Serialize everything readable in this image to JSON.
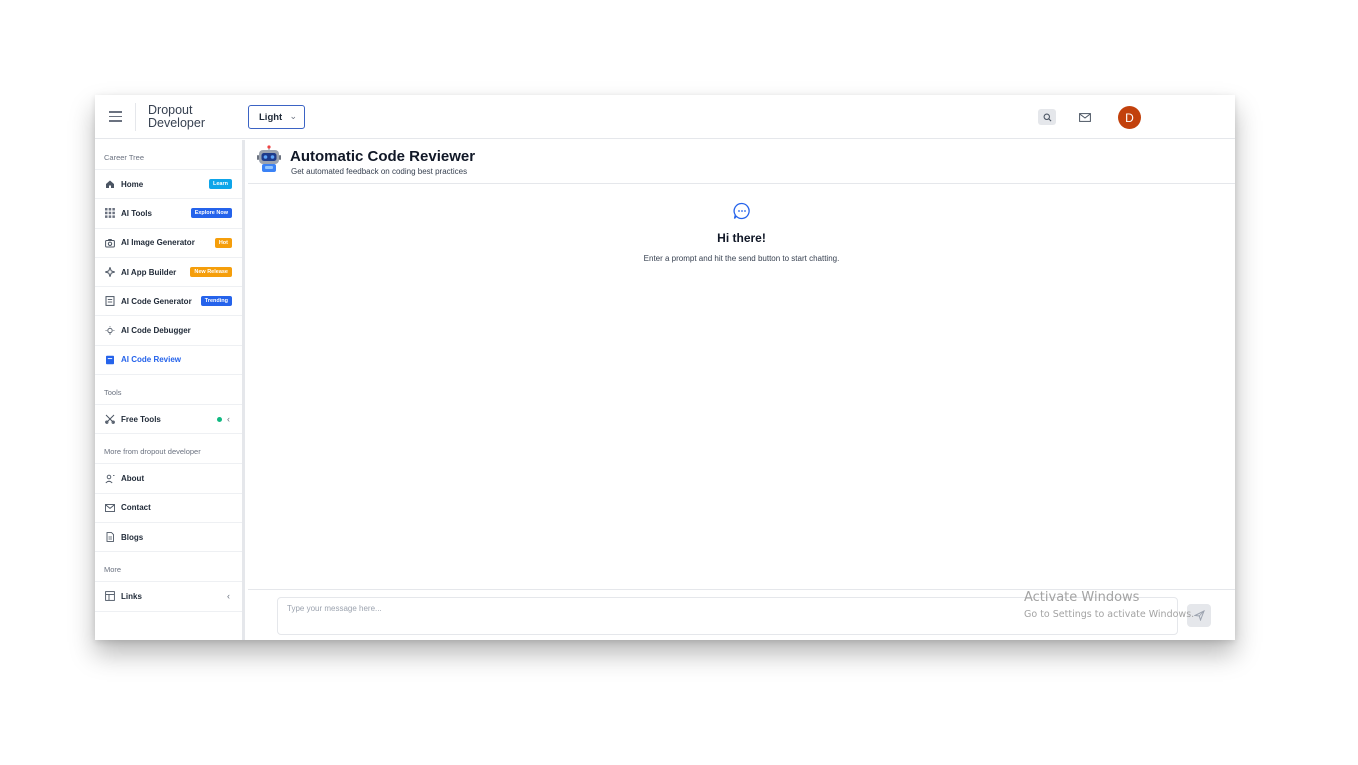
{
  "header": {
    "brand_line1": "Dropout",
    "brand_line2": "Developer",
    "theme_selected": "Light",
    "avatar_initial": "D"
  },
  "sidebar": {
    "sections": [
      {
        "label": "Career Tree"
      },
      {
        "label": "Tools"
      },
      {
        "label": "More from dropout developer"
      },
      {
        "label": "More"
      }
    ],
    "career_items": [
      {
        "label": "Home",
        "icon": "home-icon",
        "badge": "Learn"
      },
      {
        "label": "AI Tools",
        "icon": "grid-icon",
        "badge": "Explore Now"
      },
      {
        "label": "AI Image Generator",
        "icon": "camera-icon",
        "badge": "Hot"
      },
      {
        "label": "AI App Builder",
        "icon": "sparkle-icon",
        "badge": "New Release"
      },
      {
        "label": "AI Code Generator",
        "icon": "code-file-icon",
        "badge": "Trending"
      },
      {
        "label": "AI Code Debugger",
        "icon": "bulb-icon",
        "badge": ""
      },
      {
        "label": "AI Code Review",
        "icon": "review-icon",
        "badge": ""
      }
    ],
    "tools_items": [
      {
        "label": "Free Tools",
        "icon": "scissors-icon"
      }
    ],
    "more_from_items": [
      {
        "label": "About",
        "icon": "person-icon"
      },
      {
        "label": "Contact",
        "icon": "mail-icon"
      },
      {
        "label": "Blogs",
        "icon": "document-icon"
      }
    ],
    "more_items": [
      {
        "label": "Links",
        "icon": "layout-icon"
      }
    ]
  },
  "main": {
    "title": "Automatic Code Reviewer",
    "subtitle": "Get automated feedback on coding best practices",
    "welcome_title": "Hi there!",
    "welcome_text": "Enter a prompt and hit the send button to start chatting.",
    "input_placeholder": "Type your message here...",
    "input_value": ""
  },
  "watermark": {
    "title": "Activate Windows",
    "subtitle": "Go to Settings to activate Windows."
  },
  "colors": {
    "accent": "#2563eb",
    "avatar": "#c2410c",
    "badge_blue": "#0ea5e9",
    "badge_orange": "#f59e0b",
    "status_green": "#10b981"
  }
}
